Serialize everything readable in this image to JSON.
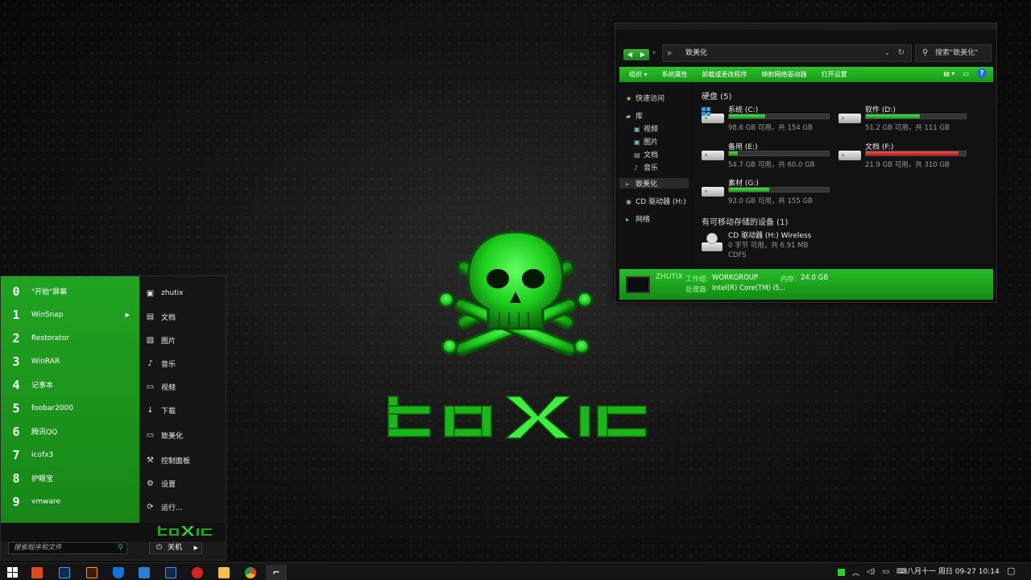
{
  "explorer": {
    "address": "致美化",
    "search_placeholder": "搜索\"致美化\"",
    "toolbar": {
      "organize": "组织 ▾",
      "system_properties": "系统属性",
      "uninstall": "卸载或更改程序",
      "map_drive": "映射网络驱动器",
      "open_settings": "打开设置"
    },
    "sidebar": {
      "quick_access": "快速访问",
      "library": "库",
      "videos": "视频",
      "pictures": "图片",
      "documents": "文档",
      "music": "音乐",
      "this_pc": "致美化",
      "cd_drive": "CD 驱动器 (H:)",
      "network": "网络"
    },
    "hard_drives_header": "硬盘 (5)",
    "drives": [
      {
        "name": "系统 (C:)",
        "free": "98.6 GB 可用，共 154 GB",
        "used_fraction": 0.36,
        "status": "normal"
      },
      {
        "name": "软件 (D:)",
        "free": "51.2 GB 可用，共 111 GB",
        "used_fraction": 0.54,
        "status": "normal"
      },
      {
        "name": "备用 (E:)",
        "free": "54.7 GB 可用，共 60.0 GB",
        "used_fraction": 0.09,
        "status": "normal"
      },
      {
        "name": "文档 (F:)",
        "free": "21.9 GB 可用，共 310 GB",
        "used_fraction": 0.93,
        "status": "full"
      },
      {
        "name": "素材 (G:)",
        "free": "93.0 GB 可用，共 155 GB",
        "used_fraction": 0.4,
        "status": "normal"
      }
    ],
    "removable_header": "有可移动存储的设备 (1)",
    "cd": {
      "name": "CD 驱动器 (H:) Wireless",
      "free": "0 字节 可用，共 6.91 MB",
      "fs": "CDFS"
    },
    "status": {
      "computer_name": "ZHUTIX",
      "workgroup_label": "工作组:",
      "workgroup": "WORKGROUP",
      "memory_label": "内存:",
      "memory": "24.0 GB",
      "cpu_label": "处理器:",
      "cpu": "Intel(R) Core(TM) i5..."
    },
    "colors": {
      "accent": "#21b021",
      "full": "#d22828"
    }
  },
  "start_menu": {
    "apps": [
      {
        "num": "0",
        "label": "\"开始\"屏幕"
      },
      {
        "num": "1",
        "label": "WinSnap",
        "has_submenu": true
      },
      {
        "num": "2",
        "label": "Restorator"
      },
      {
        "num": "3",
        "label": "WinRAR"
      },
      {
        "num": "4",
        "label": "记事本"
      },
      {
        "num": "5",
        "label": "foobar2000"
      },
      {
        "num": "6",
        "label": "腾讯QQ"
      },
      {
        "num": "7",
        "label": "icofx3"
      },
      {
        "num": "8",
        "label": "护眼宝"
      },
      {
        "num": "9",
        "label": "vmware"
      }
    ],
    "places": [
      {
        "icon": "user-icon",
        "label": "zhutix"
      },
      {
        "icon": "document-icon",
        "label": "文档"
      },
      {
        "icon": "picture-icon",
        "label": "图片"
      },
      {
        "icon": "music-icon",
        "label": "音乐"
      },
      {
        "icon": "video-icon",
        "label": "视频"
      },
      {
        "icon": "download-icon",
        "label": "下载"
      },
      {
        "icon": "computer-icon",
        "label": "致美化"
      },
      {
        "icon": "control-panel-icon",
        "label": "控制面板"
      },
      {
        "icon": "settings-icon",
        "label": "设置"
      },
      {
        "icon": "run-icon",
        "label": "运行..."
      }
    ],
    "search_placeholder": "搜索程序和文件",
    "shutdown_label": "关机"
  },
  "taskbar": {
    "clock": "八月十一  周日  09-27  10:14"
  }
}
